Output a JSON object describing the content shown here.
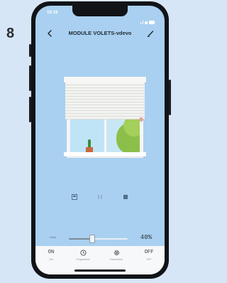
{
  "step_number": "8",
  "status_bar": {
    "time": "10:19"
  },
  "header": {
    "title": "MODULE VOLETS-vdevo"
  },
  "icons": {
    "back": "chevron-left-icon",
    "edit": "pencil-icon",
    "open": "open-shutter-icon",
    "pause": "pause-icon",
    "close": "stop-icon",
    "on": "ON",
    "programmer": "clock-icon",
    "settings": "gear-icon",
    "off": "OFF"
  },
  "slider": {
    "label": "Volet",
    "value": 40,
    "value_text": "40%"
  },
  "bottom_nav": [
    {
      "glyph": "ON",
      "label": "ON"
    },
    {
      "glyph": "",
      "label": "Programmer"
    },
    {
      "glyph": "",
      "label": "Paramètres"
    },
    {
      "glyph": "OFF",
      "label": "OFF"
    }
  ],
  "colors": {
    "screen_bg": "#a9d0f0",
    "shutter": "#f3f3f1",
    "window_frame": "#f5f5f5",
    "sky": "#bfe4f6",
    "tree": "#8cbf4a",
    "control_icon": "#4f6f8c"
  }
}
